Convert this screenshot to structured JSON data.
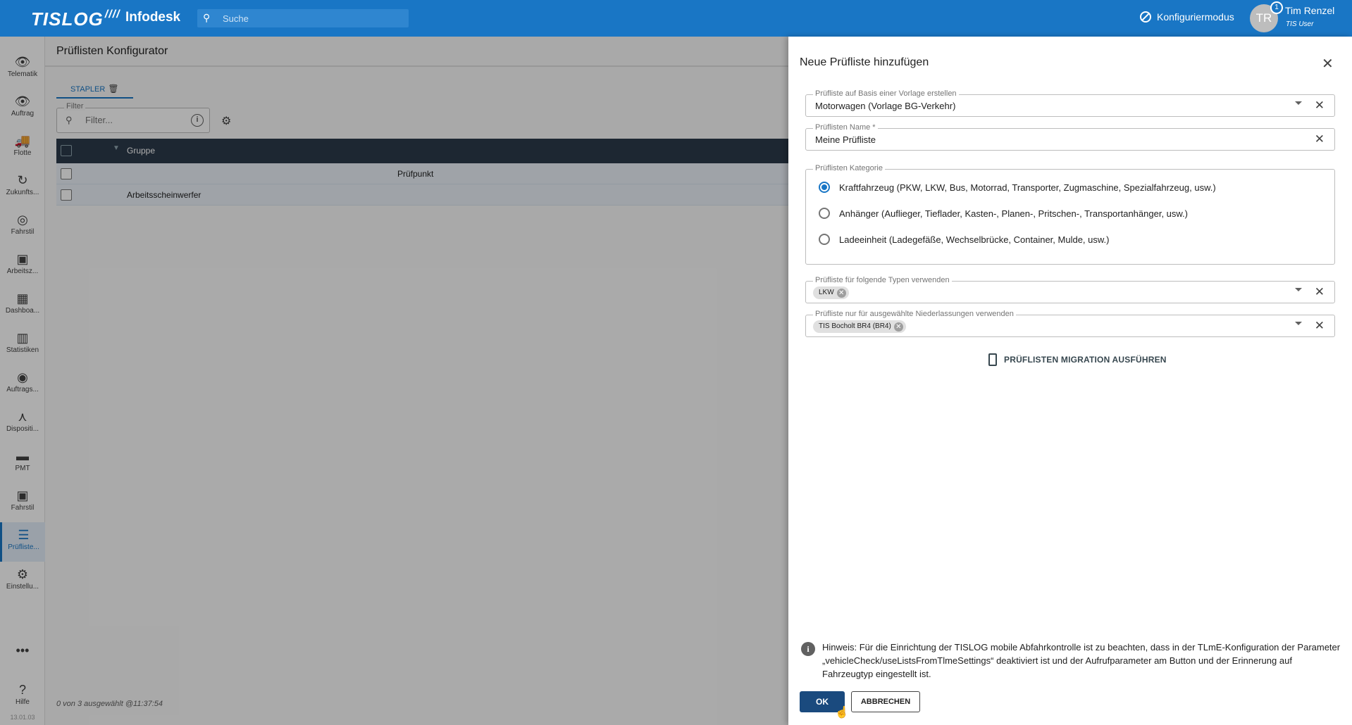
{
  "header": {
    "logo": "TISLOG",
    "app_name": "Infodesk",
    "search_placeholder": "Suche",
    "config_mode": "Konfiguriermodus",
    "user_initials": "TR",
    "notification_count": "1",
    "user_name": "Tim Renzel",
    "user_role": "TIS User"
  },
  "sidebar": {
    "items": [
      {
        "label": "Telematik",
        "icon": "binoculars-icon",
        "glyph": "👁"
      },
      {
        "label": "Auftrag",
        "icon": "binoculars-icon",
        "glyph": "👁"
      },
      {
        "label": "Flotte",
        "icon": "truck-icon",
        "glyph": "🚚"
      },
      {
        "label": "Zukunfts...",
        "icon": "history-icon",
        "glyph": "↻"
      },
      {
        "label": "Fahrstil",
        "icon": "drive-style-icon",
        "glyph": "◎"
      },
      {
        "label": "Arbeitsz...",
        "icon": "worktime-icon",
        "glyph": "▣"
      },
      {
        "label": "Dashboa...",
        "icon": "dashboard-icon",
        "glyph": "▦"
      },
      {
        "label": "Statistiken",
        "icon": "statistics-icon",
        "glyph": "▥"
      },
      {
        "label": "Auftrags...",
        "icon": "search-radar-icon",
        "glyph": "◉"
      },
      {
        "label": "Dispositi...",
        "icon": "network-icon",
        "glyph": "⋏"
      },
      {
        "label": "PMT",
        "icon": "pmt-icon",
        "glyph": "▬"
      },
      {
        "label": "Fahrstil",
        "icon": "fahrstil-icon",
        "glyph": "▣"
      },
      {
        "label": "Prüfliste...",
        "icon": "checklist-icon",
        "glyph": "☰"
      },
      {
        "label": "Einstellu...",
        "icon": "gear-icon",
        "glyph": "⚙"
      }
    ],
    "more": "•••",
    "help": "Hilfe",
    "version": "13.01.03"
  },
  "main": {
    "title": "Prüflisten Konfigurator",
    "tab": "STAPLER",
    "filter_label": "Filter",
    "filter_placeholder": "Filter...",
    "grid_header": "Gruppe",
    "group_row": "Prüfpunkt",
    "item_row": "Arbeitsscheinwerfer",
    "status": "0 von 3 ausgewählt @11:37:54"
  },
  "dialog": {
    "title": "Neue Prüfliste hinzufügen",
    "template_label": "Prüfliste auf Basis einer Vorlage erstellen",
    "template_value": "Motorwagen (Vorlage BG-Verkehr)",
    "name_label": "Prüflisten Name *",
    "name_value": "Meine Prüfliste",
    "category_label": "Prüflisten Kategorie",
    "categories": [
      "Kraftfahrzeug (PKW, LKW, Bus, Motorrad, Transporter, Zugmaschine, Spezialfahrzeug, usw.)",
      "Anhänger (Auflieger, Tieflader, Kasten-, Planen-, Pritschen-, Transportanhänger, usw.)",
      "Ladeeinheit (Ladegefäße, Wechselbrücke, Container, Mulde, usw.)"
    ],
    "selected_category_index": 0,
    "types_label": "Prüfliste für folgende Typen verwenden",
    "types_chip": "LKW",
    "branches_label": "Prüfliste nur für ausgewählte Niederlassungen verwenden",
    "branches_chip": "TIS Bocholt BR4 (BR4)",
    "migration_button": "PRÜFLISTEN MIGRATION AUSFÜHREN",
    "hint": "Hinweis: Für die Einrichtung der TISLOG mobile Abfahrkontrolle ist zu beachten, dass in der TLmE-Konfiguration der Parameter „vehicleCheck/useListsFromTlmeSettings“ deaktiviert ist und der Aufrufparameter am Button und der Erinnerung auf Fahrzeugtyp eingestellt ist.",
    "ok_button": "OK",
    "cancel_button": "ABBRECHEN"
  },
  "colors": {
    "header_bg": "#1976c5",
    "grid_header_bg": "#2c3a4a",
    "primary_button": "#1a4a7e",
    "radio_checked": "#1976c5"
  }
}
